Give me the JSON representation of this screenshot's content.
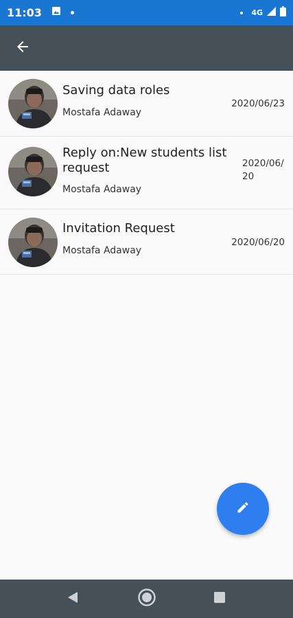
{
  "status_bar": {
    "time": "11:03",
    "network": "4G",
    "icons": [
      "image-icon",
      "notification-dot-icon",
      "dot-icon",
      "signal-icon",
      "battery-icon"
    ]
  },
  "app_bar": {
    "back_icon": "arrow-back-icon"
  },
  "messages": [
    {
      "title": "Saving data roles",
      "sender": "Mostafa Adaway",
      "date": "2020/06/23"
    },
    {
      "title": "Reply on:New students list request",
      "sender": "Mostafa Adaway",
      "date": "2020/06/20"
    },
    {
      "title": "Invitation Request",
      "sender": "Mostafa Adaway",
      "date": "2020/06/20"
    }
  ],
  "fab": {
    "icon": "pencil-icon",
    "color": "#2e7ef0"
  },
  "nav_bar": {
    "icons": [
      "back-triangle-icon",
      "home-circle-icon",
      "recents-square-icon"
    ]
  },
  "colors": {
    "status_bar": "#1976d2",
    "app_bar": "#455058",
    "background": "#fafafa"
  }
}
